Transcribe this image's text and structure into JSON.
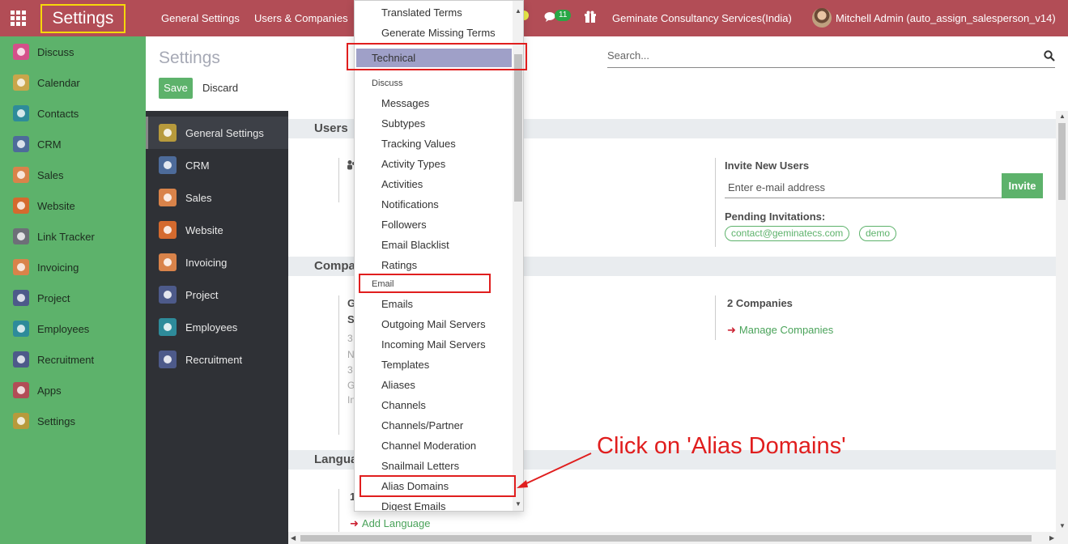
{
  "topbar": {
    "brand": "Settings",
    "menu": [
      "General Settings",
      "Users & Companies"
    ],
    "chat_count": "11",
    "company": "Geminate Consultancy Services(India)",
    "user": "Mitchell Admin (auto_assign_salesperson_v14)"
  },
  "apps": [
    {
      "label": "Discuss",
      "color": "#d4508a"
    },
    {
      "label": "Calendar",
      "color": "#c9a64b"
    },
    {
      "label": "Contacts",
      "color": "#2e8b9a"
    },
    {
      "label": "CRM",
      "color": "#4d6b9a"
    },
    {
      "label": "Sales",
      "color": "#d9834a"
    },
    {
      "label": "Website",
      "color": "#d46a2e"
    },
    {
      "label": "Link Tracker",
      "color": "#6d6f78"
    },
    {
      "label": "Invoicing",
      "color": "#d9834a"
    },
    {
      "label": "Project",
      "color": "#4d5a8a"
    },
    {
      "label": "Employees",
      "color": "#2e8b9a"
    },
    {
      "label": "Recruitment",
      "color": "#4d5a8a"
    },
    {
      "label": "Apps",
      "color": "#b24d56"
    },
    {
      "label": "Settings",
      "color": "#b79a3c"
    }
  ],
  "control_panel": {
    "breadcrumb": "Settings",
    "save": "Save",
    "discard": "Discard",
    "search_placeholder": "Search..."
  },
  "settings_nav": [
    {
      "label": "General Settings",
      "color": "#b79a3c",
      "active": true
    },
    {
      "label": "CRM",
      "color": "#4d6b9a"
    },
    {
      "label": "Sales",
      "color": "#d9834a"
    },
    {
      "label": "Website",
      "color": "#d46a2e"
    },
    {
      "label": "Invoicing",
      "color": "#d9834a"
    },
    {
      "label": "Project",
      "color": "#4d5a8a"
    },
    {
      "label": "Employees",
      "color": "#2e8b9a"
    },
    {
      "label": "Recruitment",
      "color": "#4d5a8a"
    }
  ],
  "main": {
    "users_title": "Users",
    "companies_title": "Compa",
    "languages_title": "Langua",
    "invite_title": "Invite New Users",
    "invite_placeholder": "Enter e-mail address",
    "invite_button": "Invite",
    "pending_title": "Pending Invitations:",
    "pending": [
      "contact@geminatecs.com",
      "demo"
    ],
    "companies_count": "2 Companies",
    "manage_companies": "Manage Companies",
    "company_frag": [
      "G",
      "S"
    ],
    "company_addr_frag": [
      "3",
      "N",
      "3",
      "G",
      "In"
    ],
    "language_frag": "1",
    "add_language": "Add Language"
  },
  "dropdown": {
    "top_items": [
      "Translated Terms",
      "Generate Missing Terms"
    ],
    "technical": "Technical",
    "discuss_header": "Discuss",
    "discuss_items": [
      "Messages",
      "Subtypes",
      "Tracking Values",
      "Activity Types",
      "Activities",
      "Notifications",
      "Followers",
      "Email Blacklist",
      "Ratings"
    ],
    "email_header": "Email",
    "email_items": [
      "Emails",
      "Outgoing Mail Servers",
      "Incoming Mail Servers",
      "Templates",
      "Aliases",
      "Channels",
      "Channels/Partner",
      "Channel Moderation",
      "Snailmail Letters",
      "Alias Domains",
      "Digest Emails"
    ]
  },
  "annotation": "Click on 'Alias Domains'",
  "colors": {
    "navbar": "#b24d56",
    "appbar": "#5db26b",
    "nav_dark": "#2f3136",
    "accent_green": "#5db26b",
    "annotation_red": "#e01e1e",
    "highlight_yellow": "#f6d80a"
  }
}
